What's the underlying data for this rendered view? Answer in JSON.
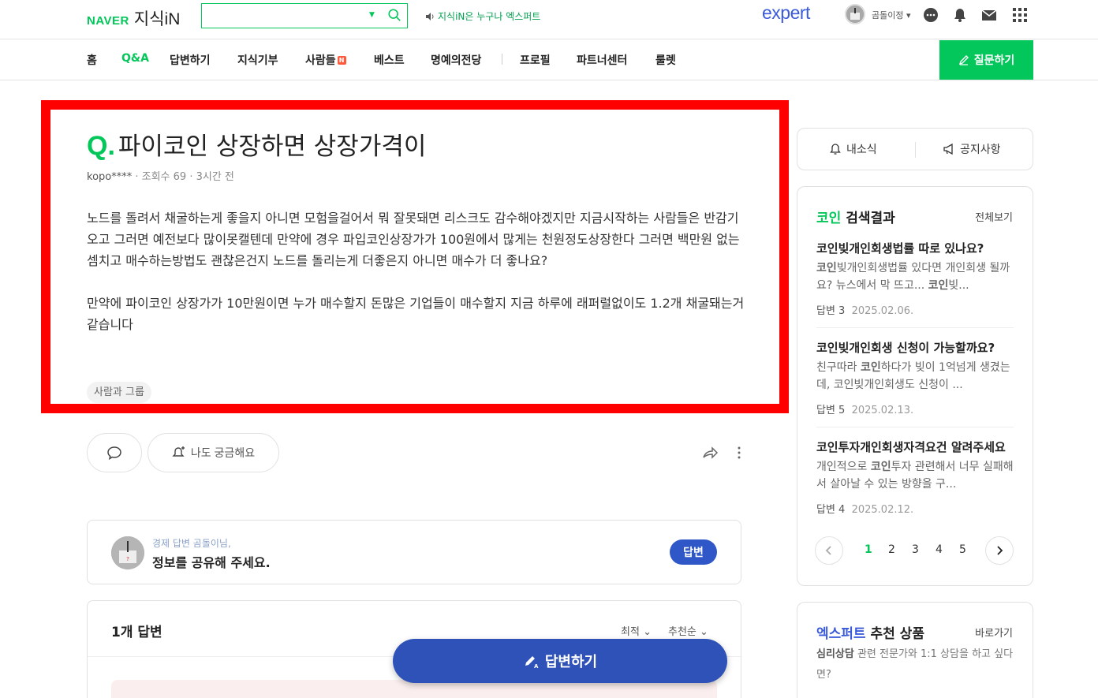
{
  "header": {
    "logo_naver": "NAVER",
    "logo_kin": "지식iN",
    "search_placeholder": "",
    "promo_text": "지식iN은 누구나 엑스퍼트",
    "expert_logo": "expert",
    "username": "곰돌이정",
    "colors": {
      "brand_green": "#03c75a",
      "expert_blue": "#3b5bdb"
    }
  },
  "nav": {
    "items": [
      {
        "label": "홈"
      },
      {
        "label": "Q&A",
        "active": true
      },
      {
        "label": "답변하기"
      },
      {
        "label": "지식기부"
      },
      {
        "label": "사람들",
        "badge": "N"
      },
      {
        "label": "베스트"
      },
      {
        "label": "명예의전당"
      },
      {
        "label": "프로필"
      },
      {
        "label": "파트너센터"
      },
      {
        "label": "룰렛"
      }
    ],
    "ask_button": "질문하기"
  },
  "question": {
    "q_mark": "Q.",
    "title": "파이코인 상장하면 상장가격이",
    "author": "kopo****",
    "views": "조회수 69",
    "time": "3시간 전",
    "body": [
      "노드를 돌려서 채굴하는게 좋을지 아니면 모험을걸어서 뭐 잘못돼면 리스크도 감수해야겠지만 지금시작하는 사람들은 반감기오고 그러면 예전보다 많이못캘텐데 만약에 경우 파입코인상장가가 100원에서 많게는 천원정도상장한다 그러면 백만원 없는셈치고 매수하는방법도 괜찮은건지 노드를 돌리는게 더좋은지 아니면 매수가 더 좋나요?",
      "만약에 파이코인 상장가가 10만원이면 누가 매수할지 돈많은 기업들이 매수할지 지금 하루에 래퍼럴없이도 1.2개 채굴돼는거 같습니다"
    ],
    "tag": "사람과 그룹"
  },
  "actions": {
    "curious_label": "나도 궁금해요"
  },
  "invite": {
    "sub": "경제 답변 곰돌이님,",
    "main": "정보를 공유해 주세요.",
    "button": "답변"
  },
  "answers": {
    "count_label": "1개 답변",
    "sort_latest": "최적",
    "sort_recommend": "추천순"
  },
  "floating_button": "답변하기",
  "sidebar": {
    "tab_news": "내소식",
    "tab_notice": "공지사항",
    "coin": {
      "keyword": "코인",
      "heading_rest": "검색결과",
      "view_all": "전체보기",
      "items": [
        {
          "title": "코인빚개인회생법률 따로 있나요?",
          "snippet_kw1": "코인",
          "snippet_1": "빚개인회생법률 있다면 개인회생 될까요? 뉴스에서 막 뜨고... ",
          "snippet_kw2": "코인",
          "snippet_2": "빚...",
          "answers": "답변 3",
          "date": "2025.02.06."
        },
        {
          "title": "코인빚개인회생 신청이 가능할까요?",
          "snippet_kw1": "",
          "snippet_1": "친구따라 ",
          "snippet_kw2": "코인",
          "snippet_2": "하다가 빚이 1억넘게 생겼는데, 코인빚개인회생도 신청이 ...",
          "answers": "답변 5",
          "date": "2025.02.13."
        },
        {
          "title": "코인투자개인회생자격요건 알려주세요",
          "snippet_kw1": "",
          "snippet_1": "개인적으로 ",
          "snippet_kw2": "코인",
          "snippet_2": "투자 관련해서 너무 실패해서 살아날 수 있는 방향을 구...",
          "answers": "답변 4",
          "date": "2025.02.12."
        }
      ],
      "pages": [
        "1",
        "2",
        "3",
        "4",
        "5"
      ],
      "current_page": "1"
    },
    "expert": {
      "keyword": "엑스퍼트",
      "heading_rest": "추천 상품",
      "go": "바로가기",
      "desc_bold": "심리상담",
      "desc": " 관련 전문가와 1:1 상담을 하고 싶다면?"
    }
  }
}
